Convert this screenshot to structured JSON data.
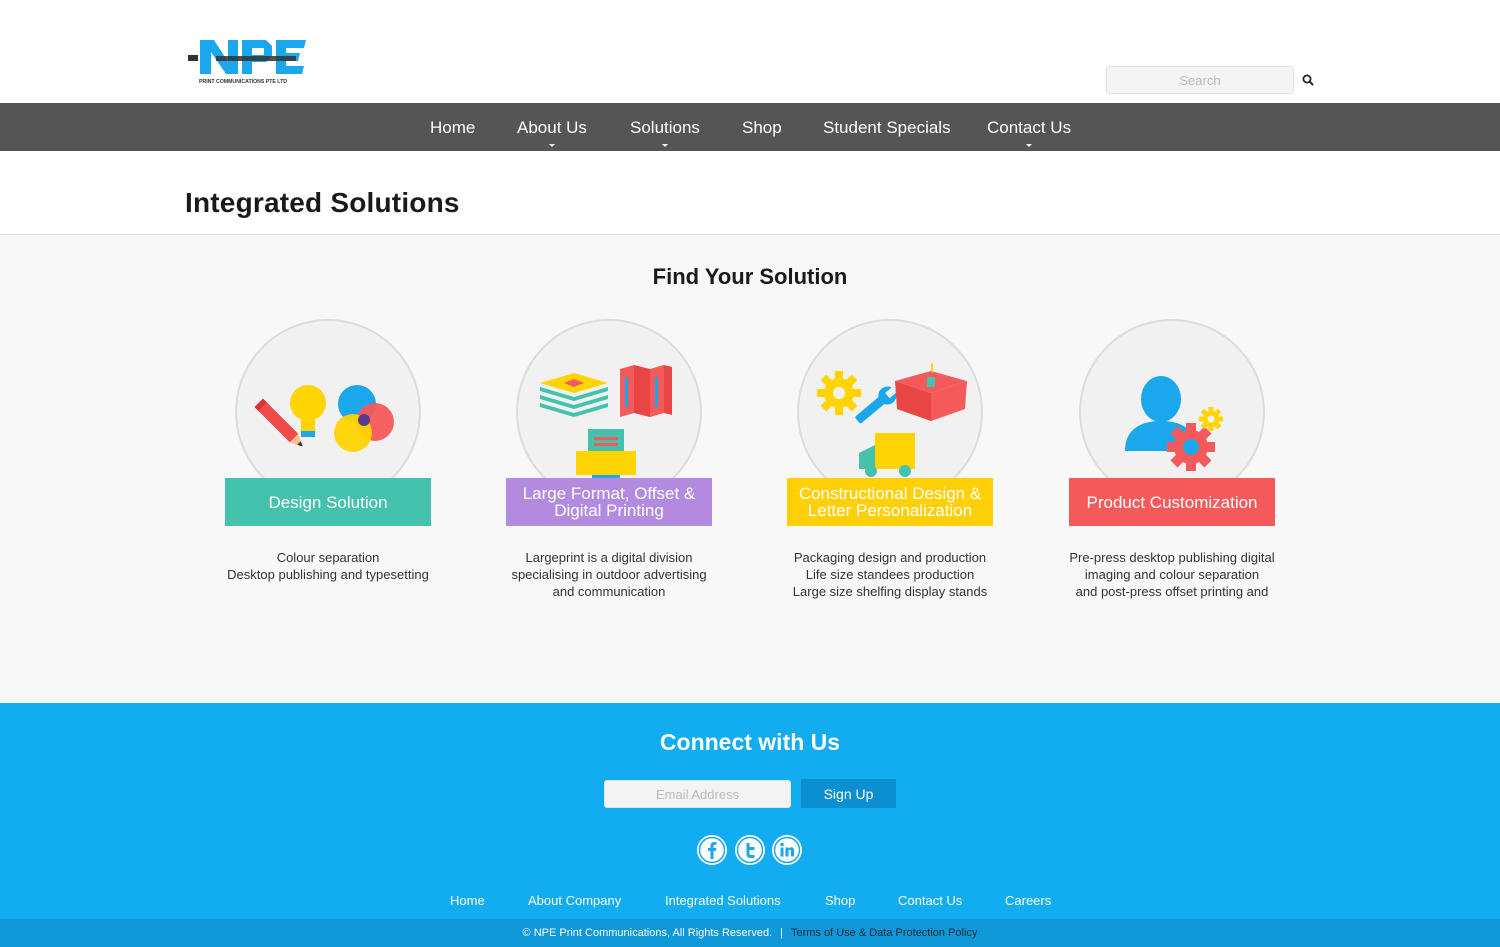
{
  "brand": {
    "logo_text": "NPE",
    "logo_subtext": "PRINT COMMUNICATIONS PTE LTD",
    "colors": {
      "logo_blue": "#1aa7ec",
      "logo_dark": "#333333",
      "nav": "#555555",
      "footer": "#12acf1",
      "footer_bar": "#0e98d8"
    }
  },
  "search": {
    "placeholder": "Search",
    "icon": "search-icon"
  },
  "nav": {
    "items": [
      {
        "label": "Home",
        "dropdown": false
      },
      {
        "label": "About Us",
        "dropdown": true
      },
      {
        "label": "Solutions",
        "dropdown": true
      },
      {
        "label": "Shop",
        "dropdown": false
      },
      {
        "label": "Student Specials",
        "dropdown": false
      },
      {
        "label": "Contact Us",
        "dropdown": true
      }
    ]
  },
  "page": {
    "title": "Integrated Solutions"
  },
  "solutions": {
    "heading": "Find Your Solution",
    "cards": [
      {
        "label": "Design Solution",
        "color": "#45c2ae",
        "icon": "design-palette-icon",
        "desc": [
          "Colour separation",
          "Desktop publishing and typesetting"
        ]
      },
      {
        "label": "Large Format, Offset & Digital Printing",
        "color": "#b28be0",
        "icon": "printer-icon",
        "desc": [
          "Largeprint is a digital division",
          "specialising in outdoor advertising",
          "and communication"
        ]
      },
      {
        "label": "Constructional Design & Letter Personalization",
        "color": "#ffcf07",
        "icon": "construction-tools-icon",
        "desc": [
          "Packaging design and production",
          "Life size standees production",
          "Large size shelfing display stands"
        ]
      },
      {
        "label": "Product Customization",
        "color": "#f55a5b",
        "icon": "user-gear-icon",
        "desc": [
          "Pre-press desktop publishing digital",
          "imaging and colour separation",
          "and post-press offset printing and"
        ]
      }
    ]
  },
  "footer": {
    "connect_title": "Connect with Us",
    "email_placeholder": "Email Address",
    "signup_label": "Sign Up",
    "social": [
      "facebook-icon",
      "twitter-icon",
      "linkedin-icon"
    ],
    "links": [
      "Home",
      "About Company",
      "Integrated Solutions",
      "Shop",
      "Contact Us",
      "Careers"
    ],
    "copyright": "© NPE Print Communications, All Rights Reserved.",
    "separator": "|",
    "policy_link": "Terms of Use & Data Protection Policy"
  }
}
